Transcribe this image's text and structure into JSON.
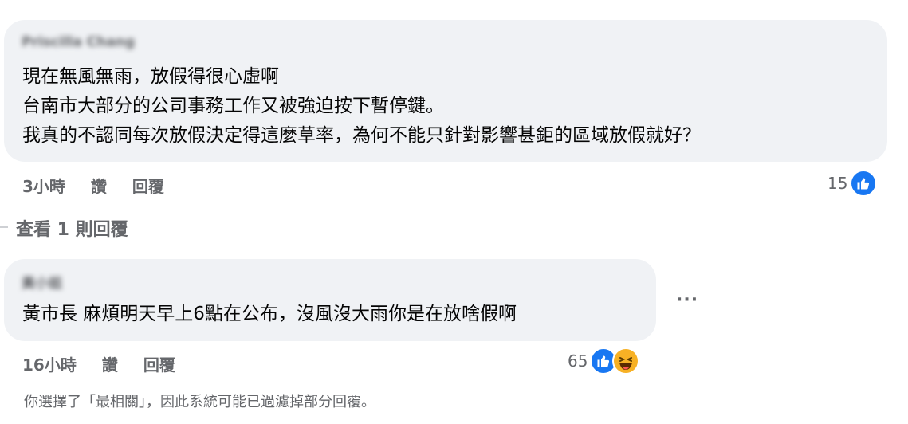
{
  "comments": [
    {
      "author": "Priscilla Chang",
      "lines": [
        "現在無風無雨，放假得很心虛啊",
        "台南市大部分的公司事務工作又被強迫按下暫停鍵。",
        "我真的不認同每次放假決定得這麼草率，為何不能只針對影響甚鉅的區域放假就好？"
      ],
      "time": "3小時",
      "like_label": "讚",
      "reply_label": "回覆",
      "reaction_count": "15"
    },
    {
      "author": "黃小姐",
      "lines": [
        "黃市長 麻煩明天早上6點在公布，沒風沒大雨你是在放啥假啊"
      ],
      "time": "16小時",
      "like_label": "讚",
      "reply_label": "回覆",
      "reaction_count": "65"
    }
  ],
  "view_replies_label": "查看 1 則回覆",
  "more_options_label": "···",
  "footer_note": "你選擇了「最相關」，因此系統可能已過濾掉部分回覆。",
  "colors": {
    "like": "#1877f2",
    "haha": "#f7b125",
    "bubble": "#f0f2f5"
  }
}
